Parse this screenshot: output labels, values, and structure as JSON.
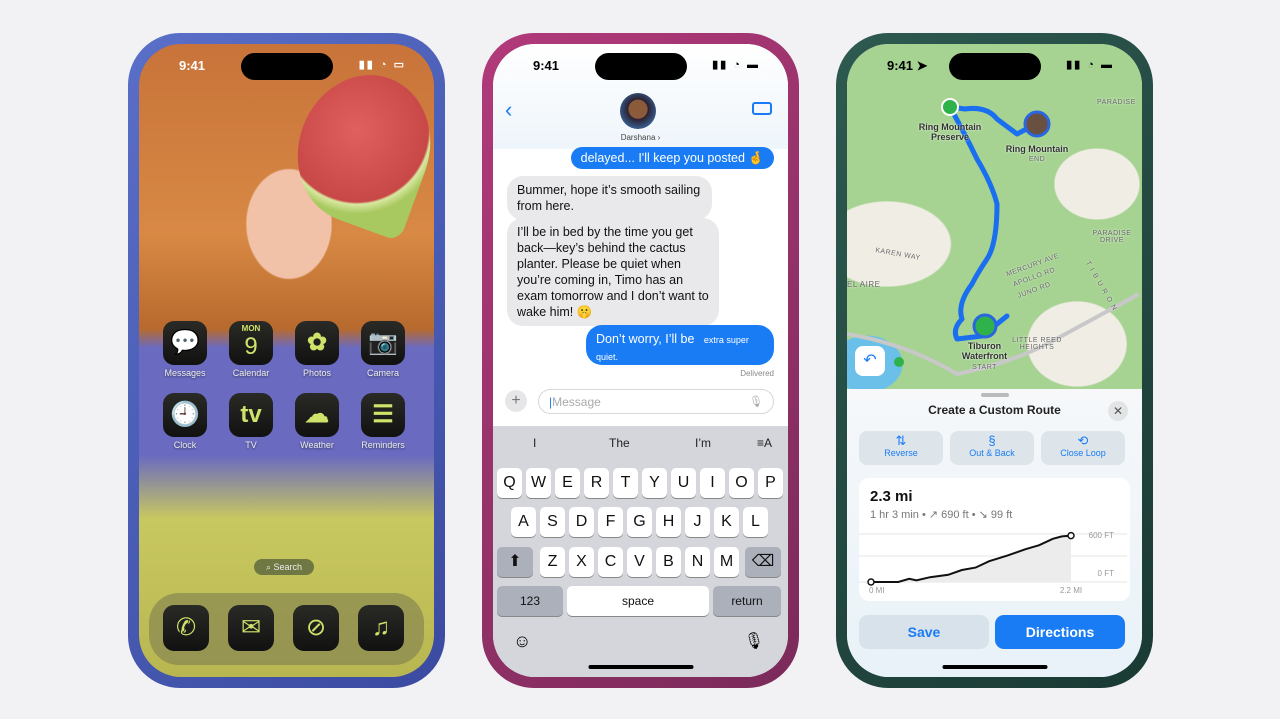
{
  "status": {
    "time": "9:41"
  },
  "home": {
    "apps": [
      {
        "label": "Messages",
        "icon": "message-bubble-icon",
        "glyph": "💬"
      },
      {
        "label": "Calendar",
        "icon": "calendar-icon",
        "day": "MON",
        "date": "9"
      },
      {
        "label": "Photos",
        "icon": "photos-flower-icon",
        "glyph": "✿"
      },
      {
        "label": "Camera",
        "icon": "camera-icon",
        "glyph": "📷"
      },
      {
        "label": "Clock",
        "icon": "clock-icon",
        "glyph": "🕘"
      },
      {
        "label": "TV",
        "icon": "apple-tv-icon",
        "glyph": "tv"
      },
      {
        "label": "Weather",
        "icon": "cloud-icon",
        "glyph": "☁"
      },
      {
        "label": "Reminders",
        "icon": "list-icon",
        "glyph": "☰"
      }
    ],
    "search_label": "Search",
    "dock": [
      {
        "icon": "phone-icon",
        "glyph": "✆"
      },
      {
        "icon": "mail-icon",
        "glyph": "✉"
      },
      {
        "icon": "compass-icon",
        "glyph": "⊘"
      },
      {
        "icon": "music-note-icon",
        "glyph": "♫"
      }
    ],
    "accent": "#cfe36a"
  },
  "messages": {
    "contact": "Darshana ›",
    "thread": [
      {
        "from": "me",
        "text": "delayed... I'll keep you posted 🤞"
      },
      {
        "from": "them",
        "text": "Bummer, hope it’s smooth sailing from here."
      },
      {
        "from": "them",
        "text": "I’ll be in bed by the time you get back—key’s behind the cactus planter. Please be quiet when you’re coming in, Timo has an exam tomorrow and I don’t want to wake him! 🤫"
      },
      {
        "from": "me",
        "text": "Don’t worry, I’ll be",
        "effect_text": "extra super quiet."
      }
    ],
    "delivered": "Delivered",
    "input_placeholder": "Message",
    "suggestions": [
      "I",
      "The",
      "I’m"
    ],
    "keyboard": {
      "row1": [
        "Q",
        "W",
        "E",
        "R",
        "T",
        "Y",
        "U",
        "I",
        "O",
        "P"
      ],
      "row2": [
        "A",
        "S",
        "D",
        "F",
        "G",
        "H",
        "J",
        "K",
        "L"
      ],
      "row3": [
        "Z",
        "X",
        "C",
        "V",
        "B",
        "N",
        "M"
      ],
      "numbers": "123",
      "space": "space",
      "return": "return"
    },
    "accent": "#1a7cf5"
  },
  "maps": {
    "labels": {
      "start_place": "Tiburon Waterfront",
      "start": "START",
      "end_place": "Ring Mountain",
      "end": "END",
      "preserve": "Ring Mountain Preserve",
      "paradise": "PARADISE",
      "paradise_drive": "PARADISE DRIVE",
      "karen": "KAREN WAY",
      "bel_aire": "EL AIRE",
      "little_reed": "LITTLE REED HEIGHTS",
      "mercury": "MERCURY AVE",
      "apollo": "APOLLO RD",
      "juno": "JUNO RD",
      "tiburon": "TIBURON"
    },
    "sheet_title": "Create a Custom Route",
    "options": [
      {
        "label": "Reverse",
        "icon": "reverse-arrows-icon",
        "glyph": "⇅"
      },
      {
        "label": "Out & Back",
        "icon": "out-and-back-icon",
        "glyph": "§"
      },
      {
        "label": "Close Loop",
        "icon": "loop-icon",
        "glyph": "⟲"
      }
    ],
    "distance": "2.3 mi",
    "summary": "1 hr 3 min • ↗ 690 ft • ↘ 99 ft",
    "elevation": {
      "type": "line",
      "x_unit": "mi",
      "y_unit": "ft",
      "xlim": [
        0,
        2.2
      ],
      "ylim": [
        0,
        600
      ],
      "x_labels": [
        "0 MI",
        "2.2 MI"
      ],
      "y_labels": [
        "600 FT",
        "0 FT"
      ],
      "points": [
        [
          0,
          0
        ],
        [
          0.3,
          0
        ],
        [
          0.42,
          40
        ],
        [
          0.5,
          20
        ],
        [
          0.65,
          60
        ],
        [
          0.85,
          90
        ],
        [
          1.0,
          150
        ],
        [
          1.15,
          180
        ],
        [
          1.3,
          260
        ],
        [
          1.5,
          330
        ],
        [
          1.7,
          410
        ],
        [
          1.85,
          460
        ],
        [
          2.0,
          540
        ],
        [
          2.1,
          570
        ],
        [
          2.2,
          580
        ]
      ]
    },
    "save": "Save",
    "directions": "Directions",
    "accent": "#1a7cf5"
  }
}
